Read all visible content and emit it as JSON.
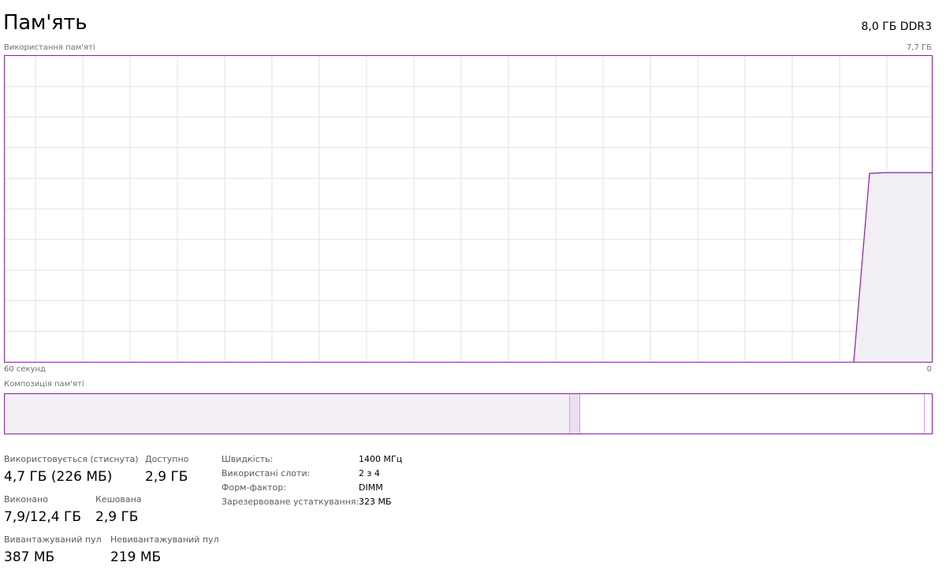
{
  "header": {
    "title": "Пам'ять",
    "memory_type": "8,0 ГБ DDR3"
  },
  "graph": {
    "usage_label": "Використання пам'яті",
    "max_label": "7,7 ГБ",
    "x_left_label": "60 секунд",
    "x_right_label": "0",
    "line_color": "#8b1da0",
    "fill_color": "#f1eef4",
    "grid_color": "#e8dced"
  },
  "composition": {
    "label": "Композиція пам'яті"
  },
  "stats": {
    "in_use_label": "Використовується (стиснута)",
    "in_use_value": "4,7 ГБ (226 МБ)",
    "available_label": "Доступно",
    "available_value": "2,9 ГБ",
    "committed_label": "Виконано",
    "committed_value": "7,9/12,4 ГБ",
    "cached_label": "Кешована",
    "cached_value": "2,9 ГБ",
    "paged_pool_label": "Вивантажуваний пул",
    "paged_pool_value": "387 МБ",
    "nonpaged_pool_label": "Невивантажуваний пул",
    "nonpaged_pool_value": "219 МБ"
  },
  "info": {
    "speed_label": "Швидкість:",
    "speed_value": "1400 МГц",
    "slots_label": "Використані слоти:",
    "slots_value": "2 з 4",
    "form_factor_label": "Форм-фактор:",
    "form_factor_value": "DIMM",
    "reserved_label": "Зарезервоване устаткування:",
    "reserved_value": "323 МБ"
  }
}
